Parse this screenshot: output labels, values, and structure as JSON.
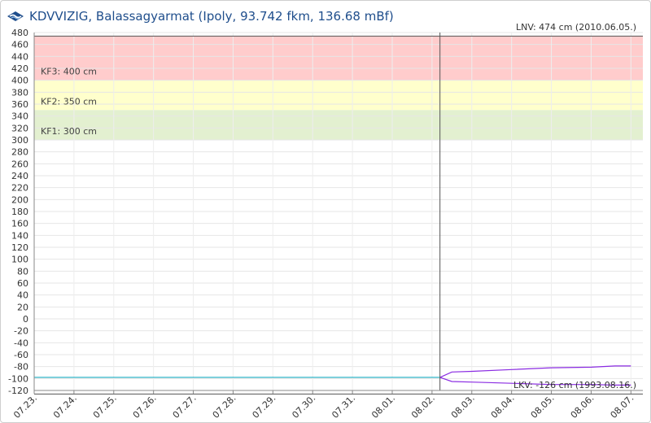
{
  "header": {
    "title": "KDVVIZIG, Balassagyarmat (Ipoly, 93.742 fkm, 136.68 mBf)",
    "logo_icon": "kdvvizig-logo-icon"
  },
  "chart_data": {
    "type": "line",
    "title": "KDVVIZIG, Balassagyarmat (Ipoly, 93.742 fkm, 136.68 mBf)",
    "xlabel": "",
    "ylabel": "",
    "ylim": [
      -120,
      480
    ],
    "yticks": [
      480,
      460,
      440,
      420,
      400,
      380,
      360,
      340,
      320,
      300,
      280,
      260,
      240,
      220,
      200,
      180,
      160,
      140,
      120,
      100,
      80,
      60,
      40,
      20,
      0,
      -20,
      -40,
      -60,
      -80,
      -100,
      -120
    ],
    "xlim": [
      0,
      15.3
    ],
    "categories": [
      "07.23.",
      "07.24.",
      "07.25.",
      "07.26.",
      "07.27.",
      "07.28.",
      "07.29.",
      "07.30.",
      "07.31.",
      "08.01.",
      "08.02.",
      "08.03.",
      "08.04.",
      "08.05.",
      "08.06.",
      "08.07."
    ],
    "grid": true,
    "now_x": 10.2,
    "zones": [
      {
        "label": "KF3: 400 cm",
        "from": 400,
        "to": 474,
        "color": "#ffcccc"
      },
      {
        "label": "KF2: 350 cm",
        "from": 350,
        "to": 400,
        "color": "#ffffcc"
      },
      {
        "label": "KF1: 300 cm",
        "from": 300,
        "to": 350,
        "color": "#e3f0d0"
      }
    ],
    "reference_lines": [
      {
        "label": "LNV: 474 cm (2010.06.05.)",
        "value": 474,
        "color": "#555555"
      },
      {
        "label": "LKV: -126 cm (1993.08.16.)",
        "value": -126,
        "color": "#555555"
      }
    ],
    "series": [
      {
        "color": "#31b5c8",
        "x": [
          0,
          10.0,
          10.2
        ],
        "y": [
          -98,
          -98,
          -98
        ]
      },
      {
        "color": "#8a2be2",
        "x": [
          10.2,
          10.5,
          11.0,
          12.0,
          13.0,
          14.0,
          14.6,
          15.0
        ],
        "y": [
          -98,
          -89,
          -88,
          -85,
          -82,
          -81,
          -79,
          -79
        ]
      },
      {
        "color": "#8a2be2",
        "x": [
          10.2,
          10.5,
          11.0,
          12.0,
          13.0,
          14.0,
          14.6,
          15.0
        ],
        "y": [
          -98,
          -105,
          -106,
          -108,
          -110,
          -110,
          -111,
          -111
        ]
      }
    ]
  }
}
